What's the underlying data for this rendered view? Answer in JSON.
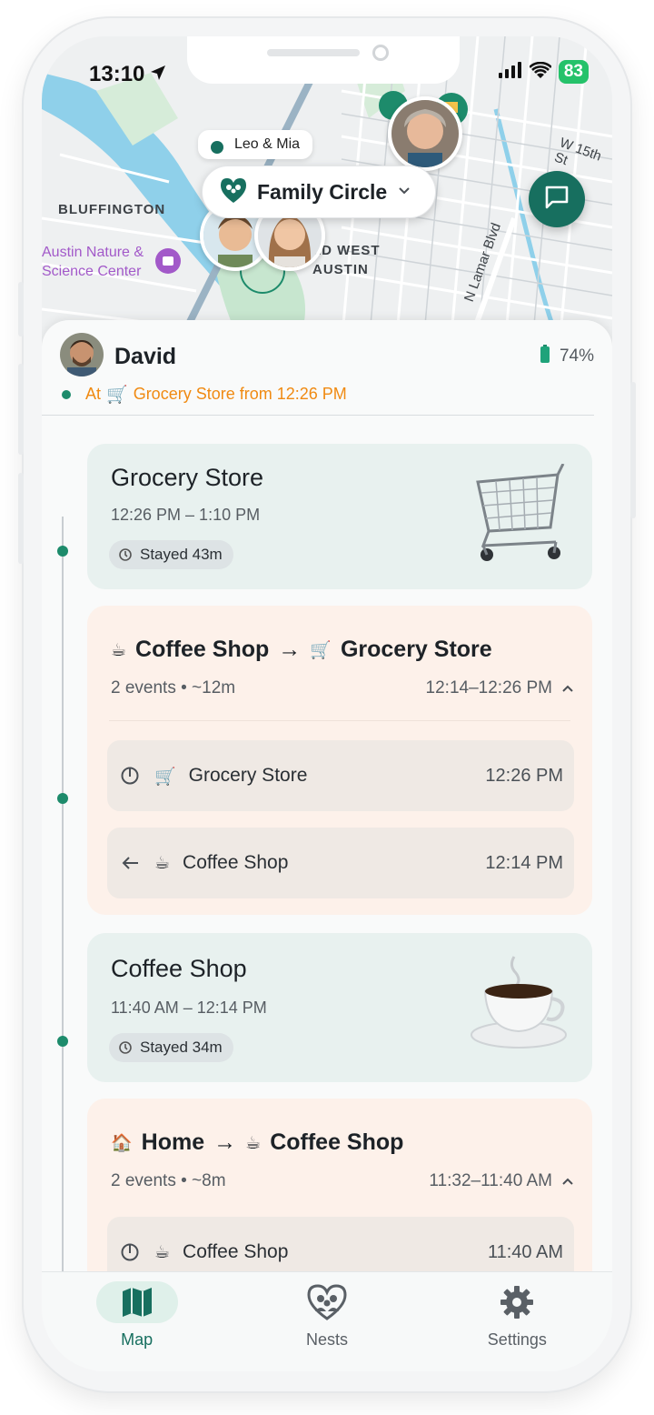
{
  "status_bar": {
    "time": "13:10",
    "battery": "83"
  },
  "map": {
    "pin_label": "Leo & Mia",
    "circle_selector": "Family Circle",
    "labels": {
      "bluffington": "BLUFFINGTON",
      "old_west": "LD WEST",
      "austin": "AUSTIN",
      "poi_line1": "Austin Nature &",
      "poi_line2": "Science Center",
      "w15th": "W 15th St",
      "n_lamar": "N Lamar Blvd"
    }
  },
  "user": {
    "name": "David",
    "battery": "74%",
    "status_prefix": "At",
    "status_icon": "shopping-cart",
    "status_text": "Grocery Store from 12:26 PM"
  },
  "timeline": {
    "stay1": {
      "title": "Grocery Store",
      "time": "12:26 PM – 1:10 PM",
      "stayed": "Stayed 43m",
      "icon": "shopping-cart"
    },
    "trip1": {
      "from": "Coffee Shop",
      "from_icon": "coffee",
      "to": "Grocery Store",
      "to_icon": "shopping-cart",
      "events": "2 events • ~12m",
      "range": "12:14–12:26 PM",
      "rows": [
        {
          "place": "Grocery Store",
          "time": "12:26 PM",
          "kind": "arrive",
          "icon": "shopping-cart"
        },
        {
          "place": "Coffee Shop",
          "time": "12:14 PM",
          "kind": "depart",
          "icon": "coffee"
        }
      ]
    },
    "stay2": {
      "title": "Coffee Shop",
      "time": "11:40 AM – 12:14 PM",
      "stayed": "Stayed 34m",
      "icon": "coffee"
    },
    "trip2": {
      "from": "Home",
      "from_icon": "house",
      "to": "Coffee Shop",
      "to_icon": "coffee",
      "events": "2 events • ~8m",
      "range": "11:32–11:40 AM",
      "rows": [
        {
          "place": "Coffee Shop",
          "time": "11:40 AM",
          "kind": "arrive",
          "icon": "coffee"
        }
      ]
    }
  },
  "nav": {
    "items": [
      {
        "label": "Map",
        "icon": "map-icon",
        "active": true
      },
      {
        "label": "Nests",
        "icon": "nests-icon",
        "active": false
      },
      {
        "label": "Settings",
        "icon": "gear-icon",
        "active": false
      }
    ]
  },
  "colors": {
    "accent": "#176f5f",
    "status_orange": "#f08a12",
    "stay_bg": "#e8f1ef",
    "trip_bg": "#fdf1ea"
  }
}
